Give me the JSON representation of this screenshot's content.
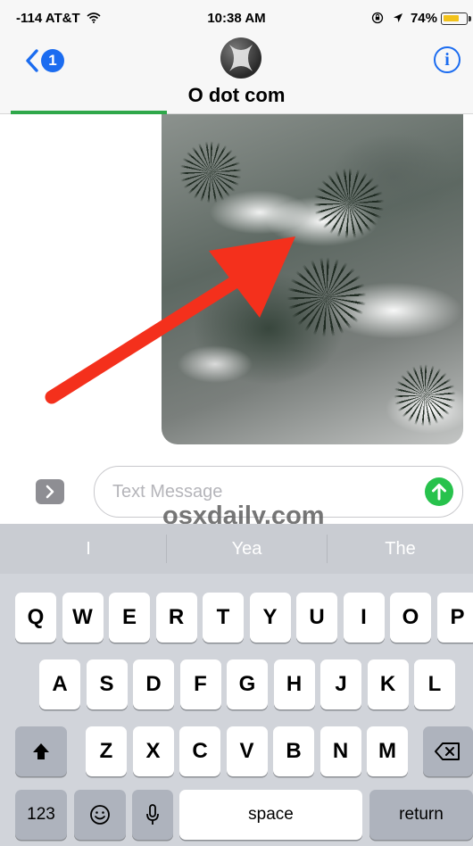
{
  "status_bar": {
    "carrier": "-114 AT&T",
    "wifi_icon": "wifi-icon",
    "time": "10:38 AM",
    "lock_icon": "orientation-lock-icon",
    "location_icon": "location-arrow-icon",
    "battery_text": "74%",
    "battery_level": 0.74,
    "battery_color": "#f2c21b"
  },
  "nav": {
    "back_badge": "1",
    "contact_name": "O dot com",
    "info_label": "i",
    "send_progress": 0.33,
    "accent_color": "#1b6cf0",
    "progress_color": "#2fa84a"
  },
  "message": {
    "attachment_type": "photo",
    "annotation": "red-arrow"
  },
  "compose": {
    "placeholder": "Text Message",
    "watermark": "osxdaily.com",
    "send_color": "#27c24c"
  },
  "keyboard": {
    "suggestions": [
      "I",
      "Yea",
      "The"
    ],
    "row1": [
      "Q",
      "W",
      "E",
      "R",
      "T",
      "Y",
      "U",
      "I",
      "O",
      "P"
    ],
    "row2": [
      "A",
      "S",
      "D",
      "F",
      "G",
      "H",
      "J",
      "K",
      "L"
    ],
    "row3": [
      "Z",
      "X",
      "C",
      "V",
      "B",
      "N",
      "M"
    ],
    "numbers_key": "123",
    "space_key": "space",
    "return_key": "return"
  }
}
